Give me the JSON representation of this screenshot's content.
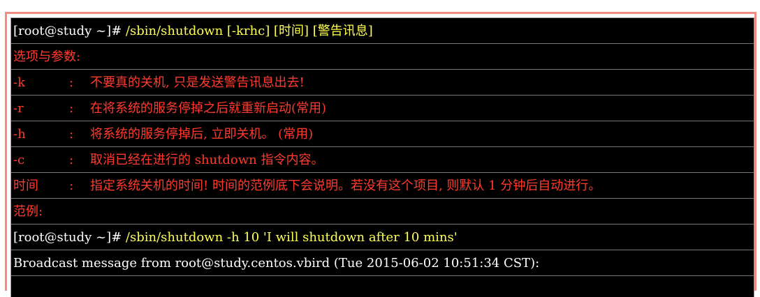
{
  "lines": {
    "l1": {
      "prompt": "[root@study ~]# ",
      "command": "/sbin/shutdown [-krhc] [时间] [警告讯息]"
    },
    "l2": {
      "text": "选项与参数:"
    },
    "l3": {
      "option": "-k",
      "sep": ":",
      "desc": "不要真的关机, 只是发送警告讯息出去!"
    },
    "l4": {
      "option": "-r",
      "sep": ":",
      "desc": "在将系统的服务停掉之后就重新启动(常用)"
    },
    "l5": {
      "option": "-h",
      "sep": ":",
      "desc": "将系统的服务停掉后, 立即关机。 (常用)"
    },
    "l6": {
      "option": "-c",
      "sep": ":",
      "desc": "取消已经在进行的 shutdown 指令内容。"
    },
    "l7": {
      "option": "时间",
      "sep": ":",
      "desc": "指定系统关机的时间! 时间的范例底下会说明。若没有这个项目, 则默认 1 分钟后自动进行。"
    },
    "l8": {
      "text": "范例:"
    },
    "l9": {
      "prompt": "[root@study ~]# ",
      "command": "/sbin/shutdown -h 10 'I will shutdown after 10 mins'"
    },
    "l10": {
      "text": "Broadcast message from root@study.centos.vbird (Tue 2015-06-02 10:51:34 CST):"
    }
  }
}
